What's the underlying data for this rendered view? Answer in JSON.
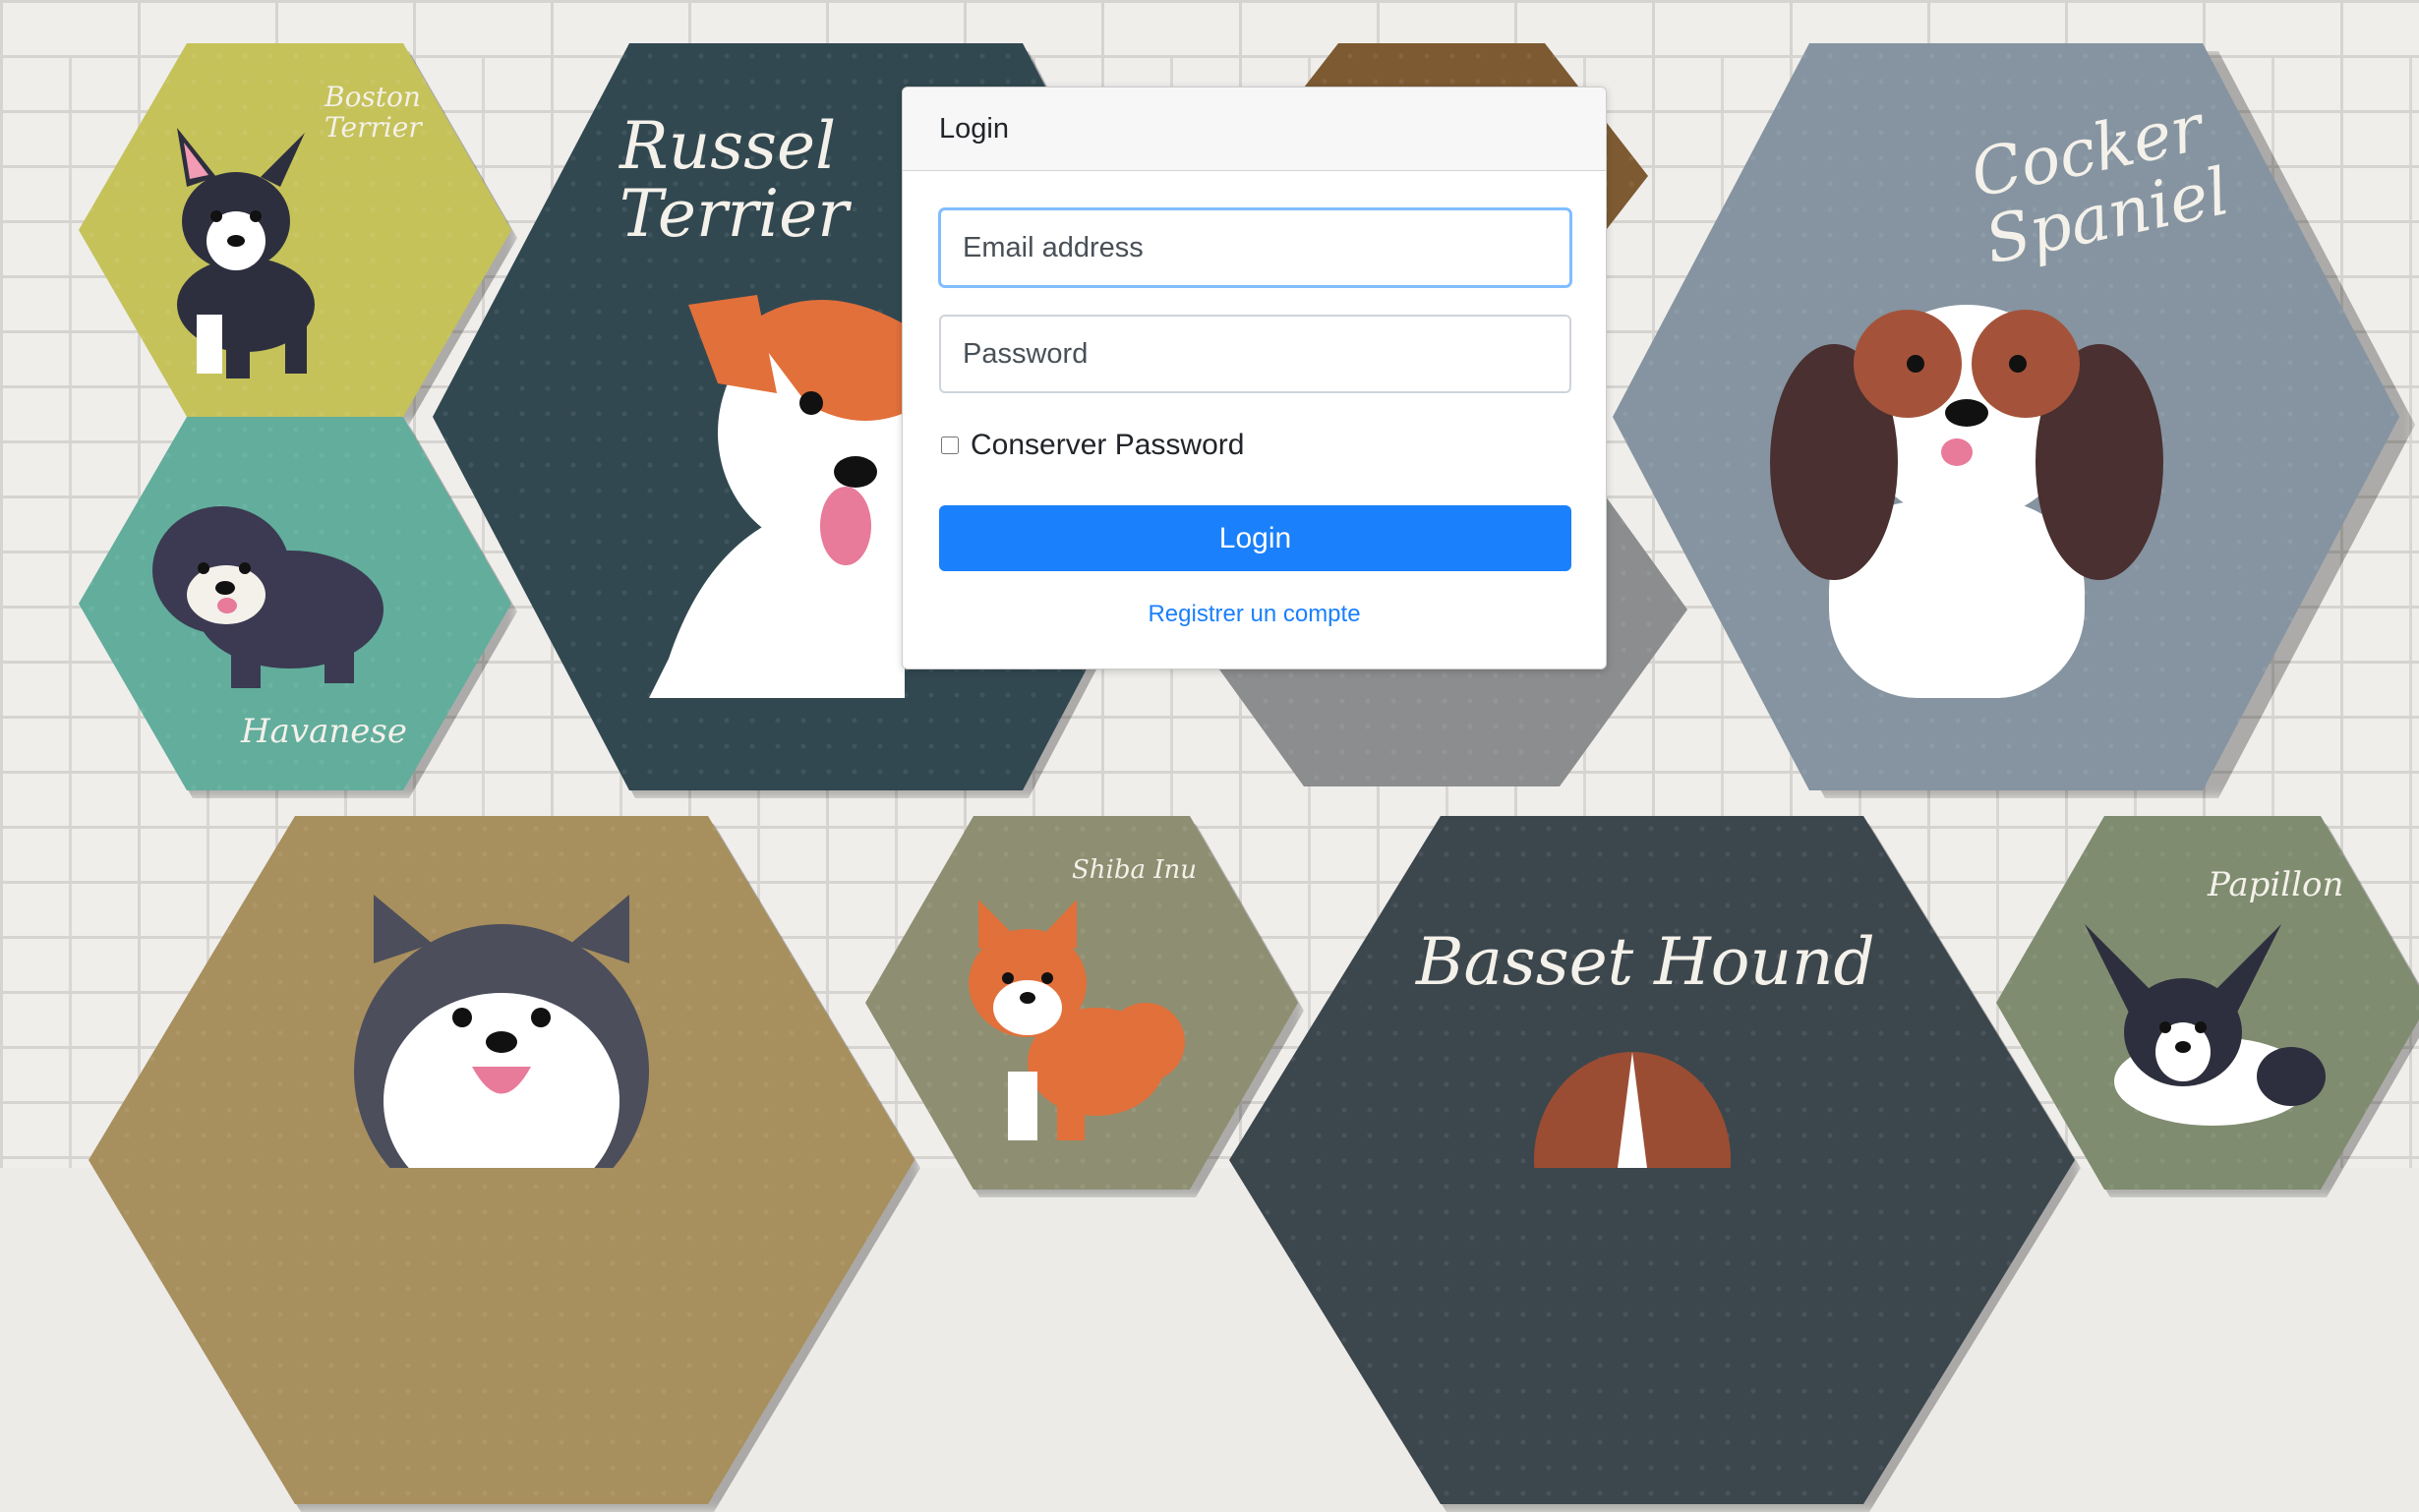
{
  "background": {
    "hexagons": [
      {
        "label": "Boston Terrier",
        "color": "#c5c25a"
      },
      {
        "label": "Havanese",
        "color": "#62ad9c"
      },
      {
        "label": "Russel Terrier",
        "color": "#324851"
      },
      {
        "label": "",
        "color": "#7d5a32"
      },
      {
        "label": "",
        "color": "#8c8d8f"
      },
      {
        "label": "Cocker Spaniel",
        "color": "#8594a0"
      },
      {
        "label": "",
        "color": "#a88f5e"
      },
      {
        "label": "Shiba Inu",
        "color": "#8e8f72"
      },
      {
        "label": "Basset Hound",
        "color": "#3c474d"
      },
      {
        "label": "Papillon",
        "color": "#7f8c6f"
      }
    ]
  },
  "login": {
    "title": "Login",
    "email_placeholder": "Email address",
    "password_placeholder": "Password",
    "remember_label": "Conserver Password",
    "submit_label": "Login",
    "register_link": "Registrer un compte"
  },
  "colors": {
    "primary": "#1a80fb"
  }
}
